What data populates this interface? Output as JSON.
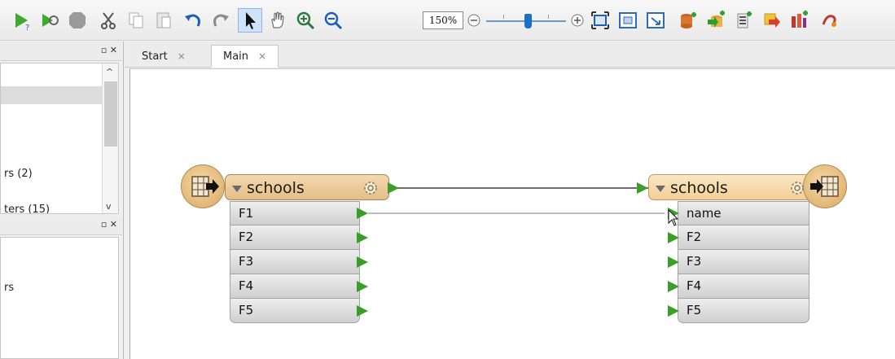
{
  "toolbar": {
    "zoom_value": "150%",
    "icons": [
      "run-with-prompt-icon",
      "run-icon",
      "stop-icon",
      "cut-icon",
      "copy-icon",
      "paste-icon",
      "undo-icon",
      "redo-icon",
      "select-tool-icon",
      "pan-tool-icon",
      "zoom-in-icon",
      "zoom-out-icon",
      "zoom-slider-minus-icon",
      "zoom-slider-plus-icon",
      "zoom-to-fit-icon",
      "zoom-extents-icon",
      "zoom-selection-icon",
      "add-reader-icon",
      "add-writer-icon",
      "add-transformer-icon",
      "add-bookmark-icon",
      "add-annotation-icon",
      "misc-icon"
    ]
  },
  "left_panel": {
    "top_list": {
      "row1": "rs (2)",
      "row2": "ters (15)"
    },
    "bottom_list": {
      "row1": "rs"
    }
  },
  "tabs": [
    {
      "label": "Start",
      "close": "×"
    },
    {
      "label": "Main",
      "close": "×"
    }
  ],
  "canvas": {
    "reader": {
      "title": "schools",
      "attributes": [
        "F1",
        "F2",
        "F3",
        "F4",
        "F5"
      ]
    },
    "writer": {
      "title": "schools",
      "attributes": [
        "name",
        "F2",
        "F3",
        "F4",
        "F5"
      ]
    }
  },
  "colors": {
    "port_green": "#3b9e2a",
    "node_header": "#e4be86",
    "slider_thumb": "#1a6fc7"
  }
}
